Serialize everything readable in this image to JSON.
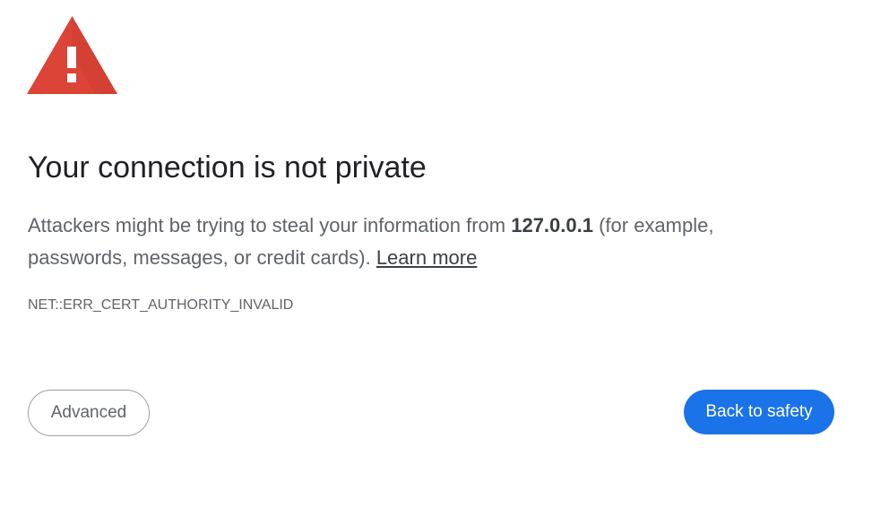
{
  "icon": {
    "name": "warning-icon",
    "color": "#db4437"
  },
  "heading": "Your connection is not private",
  "explanation": {
    "before": "Attackers might be trying to steal your information from ",
    "host": "127.0.0.1",
    "after": " (for example, passwords, messages, or credit cards). ",
    "learn_more": "Learn more"
  },
  "error_code": "NET::ERR_CERT_AUTHORITY_INVALID",
  "buttons": {
    "advanced": "Advanced",
    "back_to_safety": "Back to safety"
  },
  "colors": {
    "primary_button": "#1a73e8",
    "heading_text": "#202124",
    "body_text": "#5f6368"
  }
}
